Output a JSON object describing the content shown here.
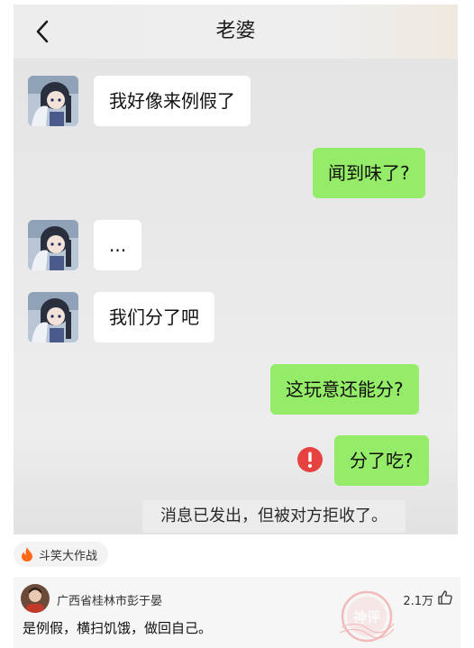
{
  "header": {
    "title": "老婆"
  },
  "messages": [
    {
      "side": "in",
      "text": "我好像来例假了"
    },
    {
      "side": "out",
      "text": "闻到味了?"
    },
    {
      "side": "in",
      "text": "..."
    },
    {
      "side": "in",
      "text": "我们分了吧"
    },
    {
      "side": "out",
      "text": "这玩意还能分?"
    },
    {
      "side": "out",
      "text": "分了吃?",
      "status": "rejected"
    }
  ],
  "system_tip": "消息已发出，但被对方拒收了。",
  "topic": {
    "label": "斗笑大作战",
    "icon": "fire-icon"
  },
  "comment": {
    "user": "广西省桂林市彭于晏",
    "text": "是例假，横扫饥饿，做回自己。",
    "likes": "2.1万",
    "stamp_text": "神评"
  },
  "colors": {
    "outgoing_bubble": "#95ec69",
    "incoming_bubble": "#ffffff",
    "error": "#e64340",
    "fire": "#ff6a1a",
    "stamp": "#f08a8a"
  }
}
